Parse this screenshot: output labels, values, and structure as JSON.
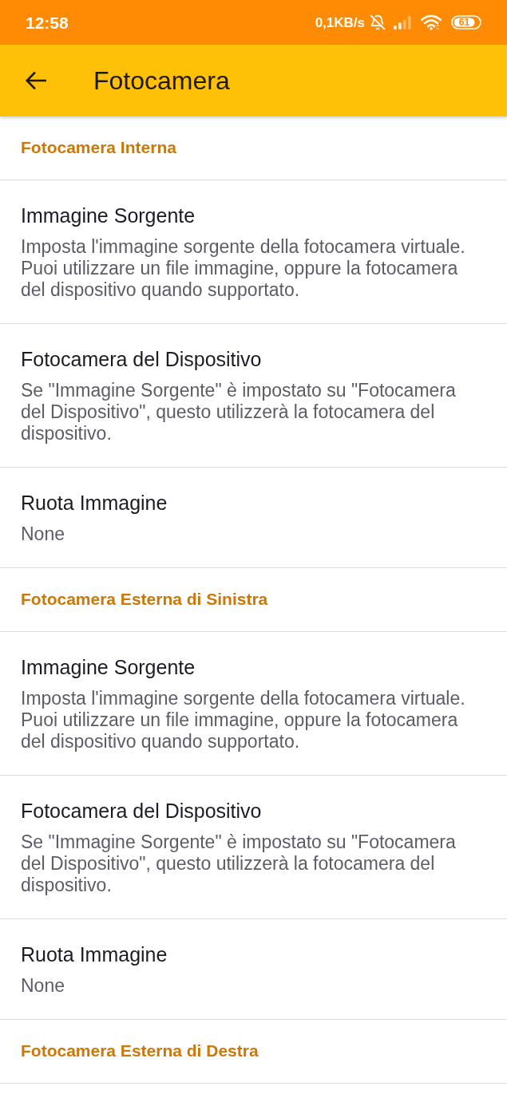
{
  "status_bar": {
    "time": "12:58",
    "network_speed": "0,1KB/s",
    "battery": "61"
  },
  "app_bar": {
    "title": "Fotocamera"
  },
  "sections": [
    {
      "title": "Fotocamera Interna",
      "items": [
        {
          "title": "Immagine Sorgente",
          "summary": "Imposta l'immagine sorgente della fotocamera virtuale. Puoi utilizzare un file immagine, oppure la fotocamera del dispositivo quando supportato."
        },
        {
          "title": "Fotocamera del Dispositivo",
          "summary": "Se \"Immagine Sorgente\" è impostato su \"Fotocamera del Dispositivo\", questo utilizzerà la fotocamera del dispositivo."
        },
        {
          "title": "Ruota Immagine",
          "summary": "None"
        }
      ]
    },
    {
      "title": "Fotocamera Esterna di Sinistra",
      "items": [
        {
          "title": "Immagine Sorgente",
          "summary": "Imposta l'immagine sorgente della fotocamera virtuale. Puoi utilizzare un file immagine, oppure la fotocamera del dispositivo quando supportato."
        },
        {
          "title": "Fotocamera del Dispositivo",
          "summary": "Se \"Immagine Sorgente\" è impostato su \"Fotocamera del Dispositivo\", questo utilizzerà la fotocamera del dispositivo."
        },
        {
          "title": "Ruota Immagine",
          "summary": "None"
        }
      ]
    },
    {
      "title": "Fotocamera Esterna di Destra"
    }
  ]
}
